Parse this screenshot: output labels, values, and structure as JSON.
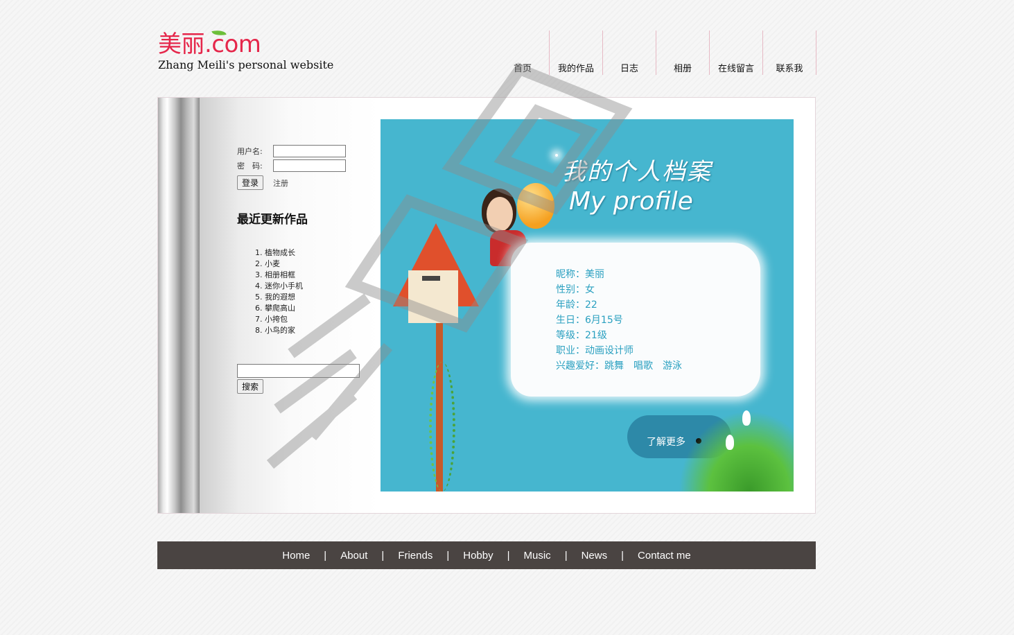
{
  "header": {
    "logo_text": "美丽.com",
    "subtitle": "Zhang Meili's personal website"
  },
  "nav": [
    {
      "label": "首页"
    },
    {
      "label": "我的作品"
    },
    {
      "label": "日志"
    },
    {
      "label": "相册"
    },
    {
      "label": "在线留言"
    },
    {
      "label": "联系我"
    }
  ],
  "login": {
    "username_label": "用户名:",
    "username_value": "",
    "password_label": "密　码:",
    "password_value": "",
    "login_button": "登录",
    "register_link": "注册"
  },
  "recent": {
    "title": "最近更新作品",
    "items": [
      "植物成长",
      "小麦",
      "相册相框",
      "迷你小手机",
      "我的遐想",
      "攀爬高山",
      "小挎包",
      "小鸟的家"
    ]
  },
  "search": {
    "value": "",
    "button": "搜索"
  },
  "banner": {
    "title_cn": "我的个人档案",
    "title_en": "My profile",
    "profile": [
      "昵称：美丽",
      "性别：女",
      "年龄：22",
      "生日：6月15号",
      "等级：21级",
      "职业：动画设计师",
      "兴趣爱好：跳舞　唱歌　游泳"
    ],
    "more": "了解更多"
  },
  "footer": {
    "links": [
      "Home",
      "About",
      "Friends",
      "Hobby",
      "Music",
      "News",
      "Contact me"
    ],
    "separator": "|"
  },
  "colors": {
    "brand": "#e5264a",
    "banner_bg": "#46b6cf",
    "footer_bg": "#4a4442",
    "profile_text": "#2aa0c0"
  }
}
